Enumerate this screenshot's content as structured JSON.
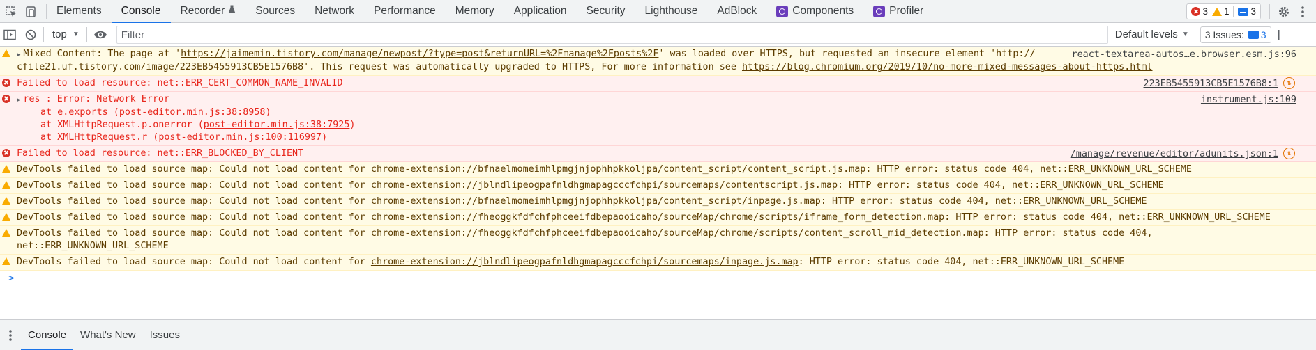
{
  "tabbar": {
    "tabs": [
      {
        "label": "Elements"
      },
      {
        "label": "Console",
        "active": true
      },
      {
        "label": "Recorder",
        "icon": "flask-icon"
      },
      {
        "label": "Sources"
      },
      {
        "label": "Network"
      },
      {
        "label": "Performance"
      },
      {
        "label": "Memory"
      },
      {
        "label": "Application"
      },
      {
        "label": "Security"
      },
      {
        "label": "Lighthouse"
      },
      {
        "label": "AdBlock"
      },
      {
        "label": "Components",
        "icon": "react-icon"
      },
      {
        "label": "Profiler",
        "icon": "react-icon"
      }
    ],
    "counts": {
      "errors": "3",
      "warnings": "1",
      "messages": "3"
    }
  },
  "toolbar": {
    "context": "top",
    "filter_placeholder": "Filter",
    "levels": "Default levels",
    "issues_label": "3 Issues:",
    "issues_count": "3"
  },
  "messages": [
    {
      "level": "warning",
      "expandable": true,
      "lines": [
        "Mixed Content: The page at 'https://jaimemin.tistory.com/manage/newpost/?type=post&returnURL=%2Fmanage%2Fposts%2F' was loaded over HTTPS, but requested an insecure element 'http://",
        "cfile21.uf.tistory.com/image/223EB5455913CB5E1576B8'. This request was automatically upgraded to HTTPS, For more information see https://blog.chromium.org/2019/10/no-more-mixed-messages-about-https.html"
      ],
      "source": "react-textarea-autos…e.browser.esm.js:96"
    },
    {
      "level": "error",
      "lines": [
        "Failed to load resource: net::ERR_CERT_COMMON_NAME_INVALID"
      ],
      "source": "223EB5455913CB5E1576B8:1",
      "source_icon": true
    },
    {
      "level": "error",
      "expandable": true,
      "lines": [
        "res :  Error: Network Error",
        "at e.exports (post-editor.min.js:38:8958)",
        "at XMLHttpRequest.p.onerror (post-editor.min.js:38:7925)",
        "at XMLHttpRequest.r (post-editor.min.js:100:116997)"
      ],
      "source": "instrument.js:109"
    },
    {
      "level": "error",
      "lines": [
        "Failed to load resource: net::ERR_BLOCKED_BY_CLIENT"
      ],
      "source": "/manage/revenue/editor/adunits.json:1",
      "source_icon": true
    },
    {
      "level": "warning",
      "lines": [
        "DevTools failed to load source map: Could not load content for chrome-extension://bfnaelmomeimhlpmgjnjophhpkkoljpa/content_script/content_script.js.map: HTTP error: status code 404, net::ERR_UNKNOWN_URL_SCHEME"
      ]
    },
    {
      "level": "warning",
      "lines": [
        "DevTools failed to load source map: Could not load content for chrome-extension://jblndlipeogpafnldhgmapagcccfchpi/sourcemaps/contentscript.js.map: HTTP error: status code 404, net::ERR_UNKNOWN_URL_SCHEME"
      ]
    },
    {
      "level": "warning",
      "lines": [
        "DevTools failed to load source map: Could not load content for chrome-extension://bfnaelmomeimhlpmgjnjophhpkkoljpa/content_script/inpage.js.map: HTTP error: status code 404, net::ERR_UNKNOWN_URL_SCHEME"
      ]
    },
    {
      "level": "warning",
      "lines": [
        "DevTools failed to load source map: Could not load content for chrome-extension://fheoggkfdfchfphceeifdbepaooicaho/sourceMap/chrome/scripts/iframe_form_detection.map: HTTP error: status code 404, net::ERR_UNKNOWN_URL_SCHEME"
      ]
    },
    {
      "level": "warning",
      "lines": [
        "DevTools failed to load source map: Could not load content for chrome-extension://fheoggkfdfchfphceeifdbepaooicaho/sourceMap/chrome/scripts/content_scroll_mid_detection.map: HTTP error: status code 404,",
        "net::ERR_UNKNOWN_URL_SCHEME"
      ]
    },
    {
      "level": "warning",
      "lines": [
        "DevTools failed to load source map: Could not load content for chrome-extension://jblndlipeogpafnldhgmapagcccfchpi/sourcemaps/inpage.js.map: HTTP error: status code 404, net::ERR_UNKNOWN_URL_SCHEME"
      ]
    }
  ],
  "prompt": ">",
  "drawer": {
    "tabs": [
      {
        "label": "Console",
        "active": true
      },
      {
        "label": "What's New"
      },
      {
        "label": "Issues"
      }
    ]
  }
}
